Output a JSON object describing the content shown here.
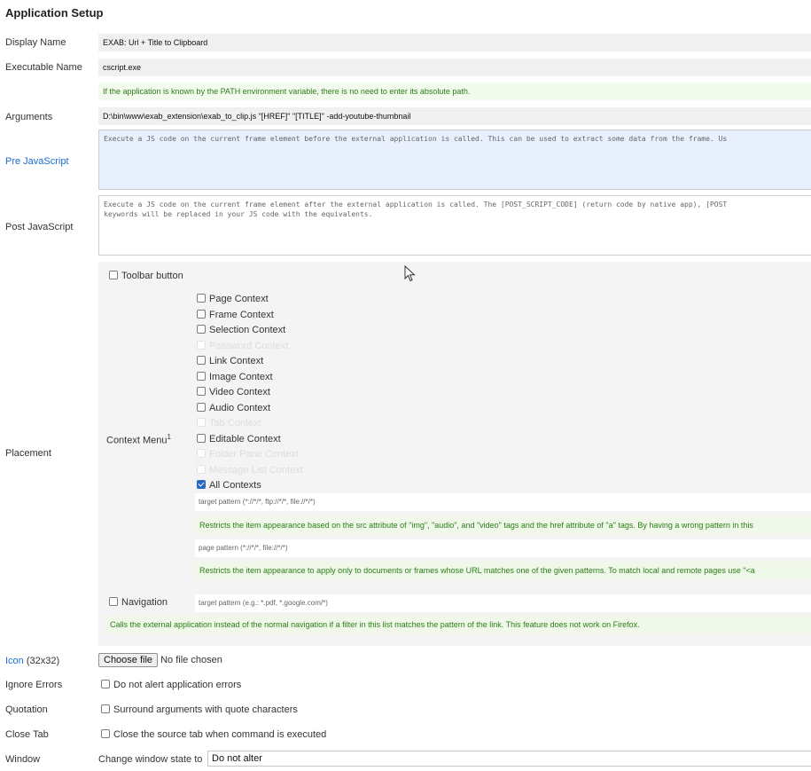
{
  "title": "Application Setup",
  "labels": {
    "display_name": "Display Name",
    "executable_name": "Executable Name",
    "arguments": "Arguments",
    "pre_js": "Pre JavaScript",
    "post_js": "Post JavaScript",
    "placement": "Placement",
    "icon": "Icon",
    "icon_size": " (32x32)",
    "ignore_errors": "Ignore Errors",
    "quotation": "Quotation",
    "close_tab": "Close Tab",
    "window": "Window"
  },
  "fields": {
    "display_name": "EXAB: Url + Title to Clipboard",
    "executable_name": "cscript.exe",
    "executable_hint": "If the application is known by the PATH environment variable, there is no need to enter its absolute path.",
    "arguments": "D:\\bin\\www\\exab_extension\\exab_to_clip.js \"[HREF]\" \"[TITLE]\" -add-youtube-thumbnail",
    "pre_js_placeholder": "Execute a JS code on the current frame element before the external application is called. This can be used to extract some data from the frame. Us",
    "post_js_placeholder": "Execute a JS code on the current frame element after the external application is called. The [POST_SCRIPT_CODE] (return code by native app), [POST\nkeywords will be replaced in your JS code with the equivalents."
  },
  "placement": {
    "toolbar_button": "Toolbar button",
    "context_menu_label": "Context Menu",
    "context_menu_sup": "1",
    "contexts": [
      {
        "label": "Page Context",
        "checked": false,
        "disabled": false
      },
      {
        "label": "Frame Context",
        "checked": false,
        "disabled": false
      },
      {
        "label": "Selection Context",
        "checked": false,
        "disabled": false
      },
      {
        "label": "Password Context",
        "checked": false,
        "disabled": true
      },
      {
        "label": "Link Context",
        "checked": false,
        "disabled": false
      },
      {
        "label": "Image Context",
        "checked": false,
        "disabled": false
      },
      {
        "label": "Video Context",
        "checked": false,
        "disabled": false
      },
      {
        "label": "Audio Context",
        "checked": false,
        "disabled": false
      },
      {
        "label": "Tab Context",
        "checked": false,
        "disabled": true
      },
      {
        "label": "Editable Context",
        "checked": false,
        "disabled": false
      },
      {
        "label": "Folder Pane Context",
        "checked": false,
        "disabled": true
      },
      {
        "label": "Message List Context",
        "checked": false,
        "disabled": true
      },
      {
        "label": "All Contexts",
        "checked": true,
        "disabled": false
      }
    ],
    "target_pattern_placeholder": "target pattern (*://*/*, ftp://*/*, file://*/*)",
    "target_pattern_hint": "Restricts the item appearance based on the src attribute of \"img\", \"audio\", and \"video\" tags and the href attribute of \"a\" tags. By having a wrong pattern in this",
    "page_pattern_placeholder": "page pattern (*://*/*, file://*/*)",
    "page_pattern_hint": "Restricts the item appearance to apply only to documents or frames whose URL matches one of the given patterns. To match local and remote pages use \"<a",
    "navigation_label": "Navigation",
    "navigation_placeholder": "target pattern (e.g.: *.pdf, *.google.com/*)",
    "navigation_hint": "Calls the external application instead of the normal navigation if a filter in this list matches the pattern of the link. This feature does not work on Firefox."
  },
  "icon": {
    "button": "Choose file",
    "status": "No file chosen"
  },
  "options": {
    "ignore_errors": "Do not alert application errors",
    "quotation": "Surround arguments with quote characters",
    "close_tab": "Close the source tab when command is executed"
  },
  "window": {
    "prefix": "Change window state to",
    "value": "Do not alter"
  }
}
